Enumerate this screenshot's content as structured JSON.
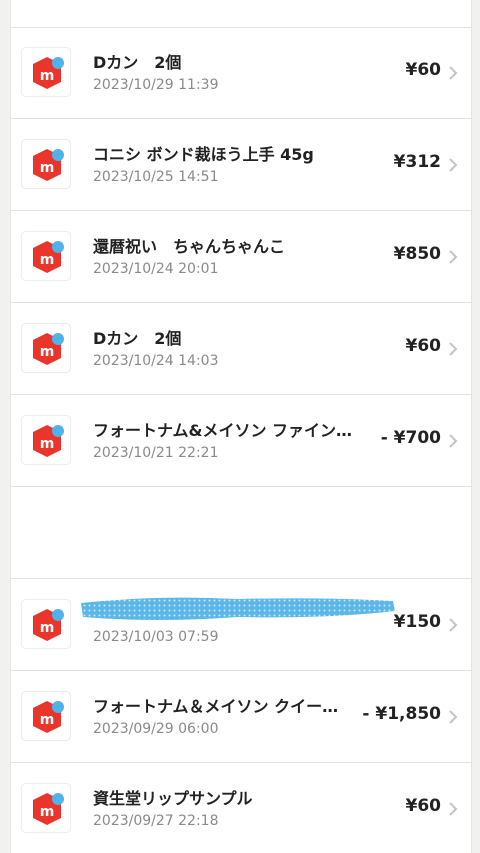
{
  "items": [
    {
      "title": "Dカン　2個",
      "date": "2023/10/29 11:39",
      "price": "¥60"
    },
    {
      "title": "コニシ ボンド裁ほう上手 45g",
      "date": "2023/10/25 14:51",
      "price": "¥312"
    },
    {
      "title": "還暦祝い　ちゃんちゃんこ",
      "date": "2023/10/24 20:01",
      "price": "¥850"
    },
    {
      "title": "Dカン　2個",
      "date": "2023/10/24 14:03",
      "price": "¥60"
    },
    {
      "title": "フォートナム&メイソン ファイン…",
      "date": "2023/10/21 22:21",
      "price": "- ¥700"
    },
    {
      "title": "",
      "date": "2023/10/03 07:59",
      "price": "¥150"
    },
    {
      "title": "フォートナム＆メイソン クイー…",
      "date": "2023/09/29 06:00",
      "price": "- ¥1,850"
    },
    {
      "title": "資生堂リップサンプル",
      "date": "2023/09/27 22:18",
      "price": "¥60"
    }
  ],
  "colors": {
    "brand": "#ea352d",
    "badge": "#4fb3ea"
  },
  "icons": {
    "logo": "mercari-logo-icon",
    "chevron": "chevron-right-icon"
  }
}
